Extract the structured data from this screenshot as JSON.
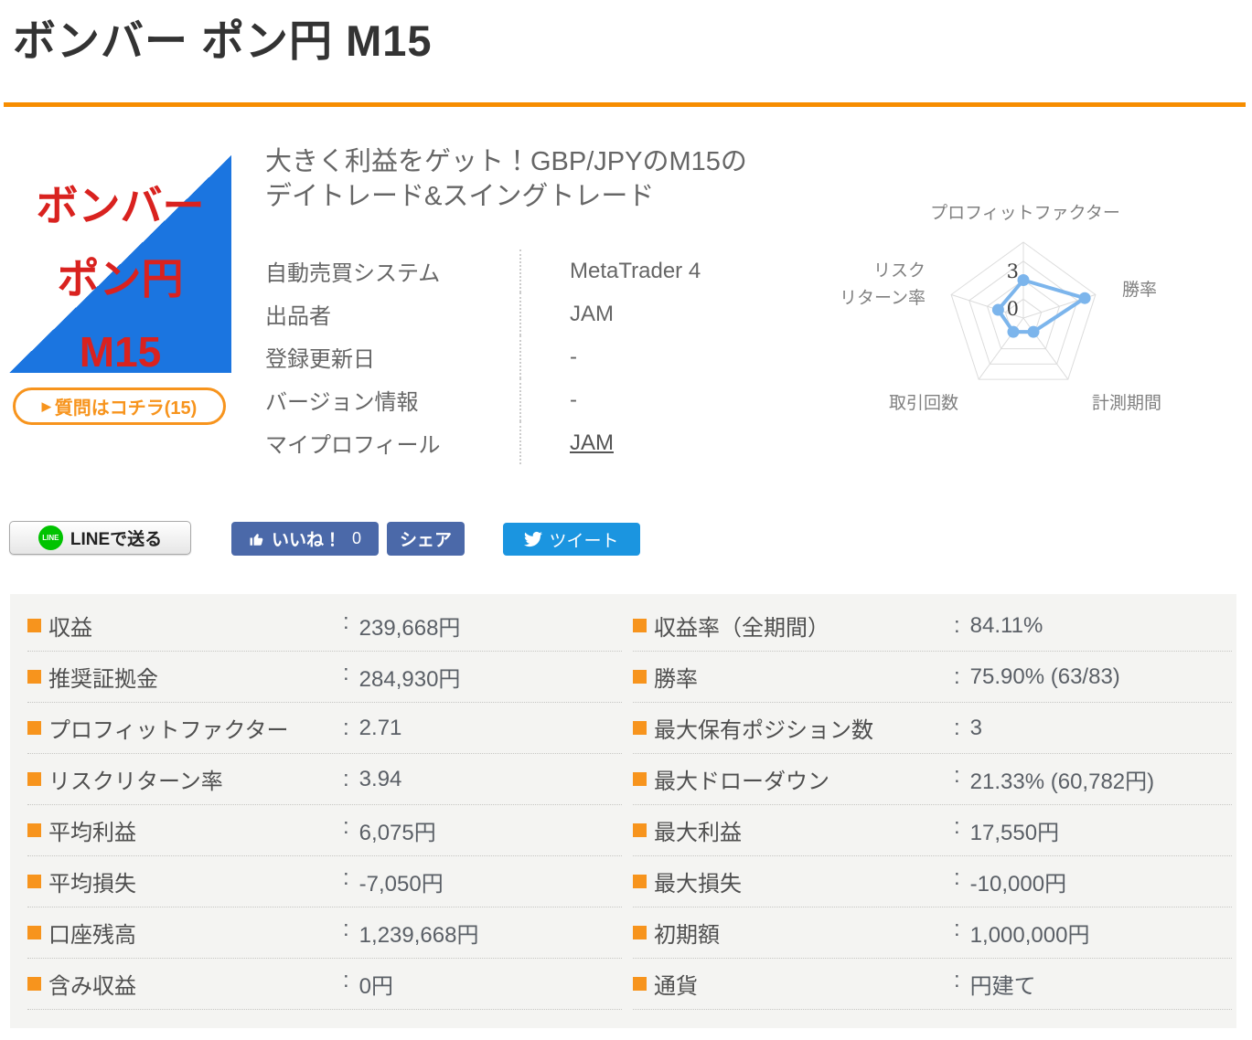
{
  "page": {
    "title": "ボンバー ポン円 M15"
  },
  "product": {
    "image_lines": [
      "ボンバー",
      "ポン円",
      "M15"
    ],
    "question_button": {
      "arrow": "▶",
      "label": "質問はコチラ(15)"
    },
    "headline_line1": "大きく利益をゲット！GBP/JPYのM15の",
    "headline_line2": "デイトレード&スイングトレード",
    "info": [
      {
        "label": "自動売買システム",
        "value": "MetaTrader 4"
      },
      {
        "label": "出品者",
        "value": "JAM"
      },
      {
        "label": "登録更新日",
        "value": "-"
      },
      {
        "label": "バージョン情報",
        "value": "-"
      },
      {
        "label": "マイプロフィール",
        "value": "JAM"
      }
    ]
  },
  "radar_chart": {
    "type": "radar",
    "axis_labels": {
      "top": "プロフィットファクター",
      "right": "勝率",
      "bottom_right": "計測期間",
      "bottom_left": "取引回数",
      "left_line1": "リスク",
      "left_line2": "リターン率"
    },
    "ticks": {
      "t3": "3",
      "t0": "0"
    },
    "max": 4,
    "levels": 4,
    "values_order": [
      "プロフィットファクター",
      "勝率",
      "計測期間",
      "取引回数",
      "リスクリターン率"
    ],
    "values": [
      2.0,
      3.4,
      0.9,
      0.9,
      1.4
    ]
  },
  "social": {
    "line_badge": "LINE",
    "line_label": "LINEで送る",
    "like_label": "いいね！",
    "like_count": "0",
    "share_label": "シェア",
    "tweet_label": "ツイート"
  },
  "stats": {
    "colon": ":",
    "left": [
      {
        "label": "収益",
        "value": "239,668円"
      },
      {
        "label": "推奨証拠金",
        "value": "284,930円"
      },
      {
        "label": "プロフィットファクター",
        "value": "2.71"
      },
      {
        "label": "リスクリターン率",
        "value": "3.94"
      },
      {
        "label": "平均利益",
        "value": "6,075円"
      },
      {
        "label": "平均損失",
        "value": "-7,050円"
      },
      {
        "label": "口座残高",
        "value": "1,239,668円"
      },
      {
        "label": "含み収益",
        "value": "0円"
      }
    ],
    "right": [
      {
        "label": "収益率（全期間）",
        "value": "84.11%"
      },
      {
        "label": "勝率",
        "value": "75.90% (63/83)"
      },
      {
        "label": "最大保有ポジション数",
        "value": "3"
      },
      {
        "label": "最大ドローダウン",
        "value": "21.33% (60,782円)"
      },
      {
        "label": "最大利益",
        "value": "17,550円"
      },
      {
        "label": "最大損失",
        "value": "-10,000円"
      },
      {
        "label": "初期額",
        "value": "1,000,000円"
      },
      {
        "label": "通貨",
        "value": "円建て"
      }
    ]
  },
  "colors": {
    "accent_orange": "#f7941d",
    "rule_orange": "#f78d00",
    "radar_blue": "#7cb5ec",
    "facebook_blue": "#4b69a9",
    "twitter_blue": "#1b95e0",
    "line_green": "#00c300",
    "image_blue": "#1b75e0",
    "image_red": "#d9221f"
  }
}
